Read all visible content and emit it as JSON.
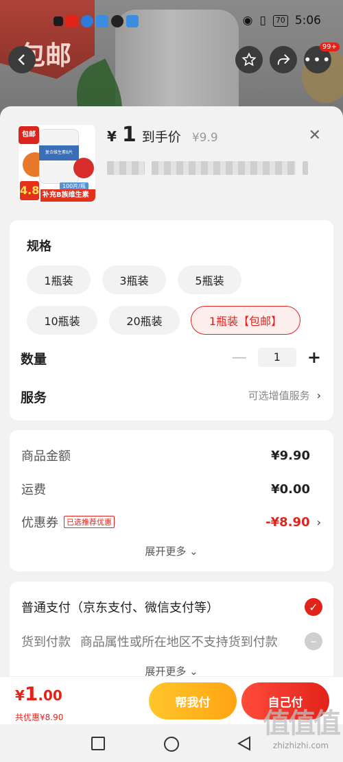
{
  "status_bar": {
    "time": "5:06",
    "battery": "70",
    "badge": "99+"
  },
  "bg": {
    "flag_text": "包邮"
  },
  "product": {
    "thumb_tag": "包邮",
    "thumb_label": "复合维生素B片",
    "thumb_price": "4.8",
    "thumb_pack": "100片/瓶",
    "thumb_banner": "补充B族维生素",
    "currency": "¥",
    "price": "1",
    "price_label": "到手价",
    "original_price": "¥9.9"
  },
  "spec": {
    "title": "规格",
    "options": [
      "1瓶装",
      "3瓶装",
      "5瓶装",
      "10瓶装",
      "20瓶装",
      "1瓶装【包邮】"
    ]
  },
  "quantity": {
    "label": "数量",
    "value": "1"
  },
  "service": {
    "label": "服务",
    "value": "可选增值服务"
  },
  "fees": {
    "items": [
      {
        "label": "商品金额",
        "value": "¥9.90"
      },
      {
        "label": "运费",
        "value": "¥0.00"
      },
      {
        "label": "优惠券",
        "tag": "已选推荐优惠",
        "value": "-¥8.90"
      }
    ],
    "expand": "展开更多"
  },
  "payment": {
    "normal": "普通支付（京东支付、微信支付等）",
    "cod_label": "货到付款",
    "cod_note": "商品属性或所在地区不支持货到付款",
    "expand": "展开更多"
  },
  "bottom": {
    "currency": "¥",
    "total_int": "1",
    "total_dec": ".00",
    "saved": "共优惠¥8.90",
    "help_pay": "帮我付",
    "self_pay": "自己付"
  },
  "watermark": {
    "big": "值值值",
    "small": "zhizhizhi.com"
  },
  "colors": {
    "accent": "#e2231a",
    "help_btn": "#ffb41c"
  }
}
